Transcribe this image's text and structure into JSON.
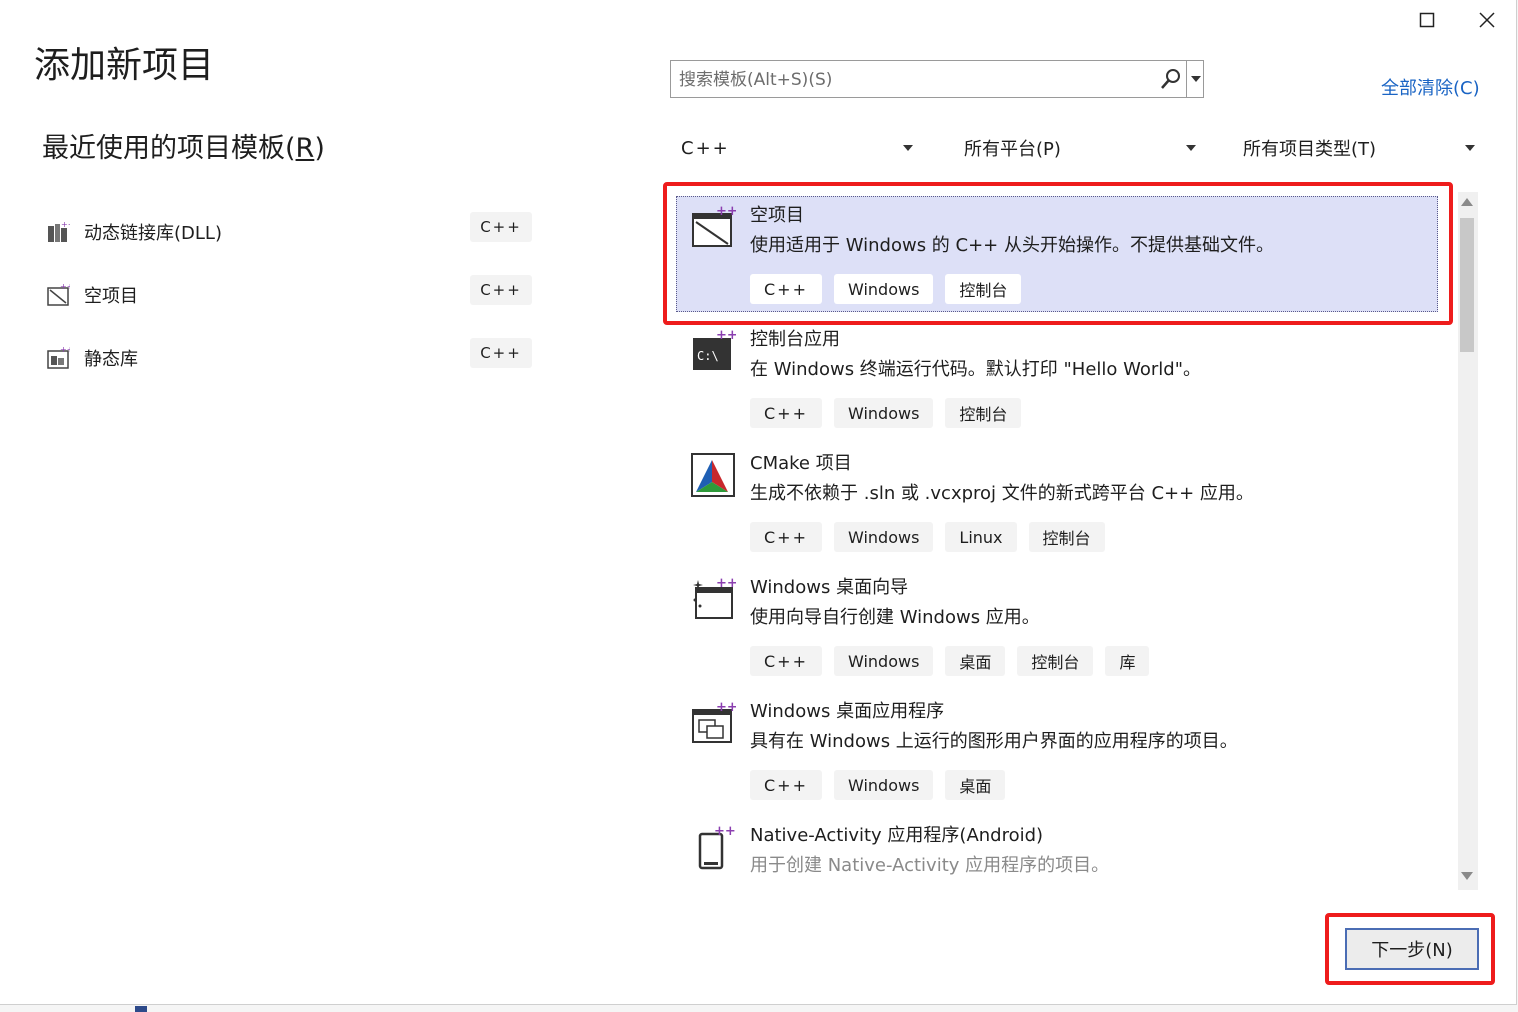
{
  "window": {
    "title": "添加新项目",
    "maximize_icon": "maximize-icon",
    "close_icon": "close-icon"
  },
  "recent": {
    "title": "最近使用的项目模板(",
    "title_key": "R",
    "title_end": ")",
    "items": [
      {
        "label": "动态链接库(DLL)",
        "lang": "C++",
        "icon": "dll-project-icon"
      },
      {
        "label": "空项目",
        "lang": "C++",
        "icon": "empty-project-icon"
      },
      {
        "label": "静态库",
        "lang": "C++",
        "icon": "static-library-icon"
      }
    ]
  },
  "search": {
    "placeholder": "搜索模板(Alt+S)(S)"
  },
  "clear_all": "全部清除(C)",
  "filters": {
    "language": "C++",
    "platform": "所有平台(P)",
    "project_type": "所有项目类型(T)"
  },
  "templates": [
    {
      "name": "空项目",
      "desc": "使用适用于 Windows 的 C++ 从头开始操作。不提供基础文件。",
      "tags": [
        "C++",
        "Windows",
        "控制台"
      ],
      "icon": "empty-project-icon",
      "selected": true
    },
    {
      "name": "控制台应用",
      "desc": "在 Windows 终端运行代码。默认打印 \"Hello World\"。",
      "tags": [
        "C++",
        "Windows",
        "控制台"
      ],
      "icon": "console-app-icon"
    },
    {
      "name": "CMake 项目",
      "desc": "生成不依赖于 .sln 或 .vcxproj 文件的新式跨平台 C++ 应用。",
      "tags": [
        "C++",
        "Windows",
        "Linux",
        "控制台"
      ],
      "icon": "cmake-icon"
    },
    {
      "name": "Windows 桌面向导",
      "desc": "使用向导自行创建 Windows 应用。",
      "tags": [
        "C++",
        "Windows",
        "桌面",
        "控制台",
        "库"
      ],
      "icon": "desktop-wizard-icon"
    },
    {
      "name": "Windows 桌面应用程序",
      "desc": "具有在 Windows 上运行的图形用户界面的应用程序的项目。",
      "tags": [
        "C++",
        "Windows",
        "桌面"
      ],
      "icon": "desktop-app-icon"
    },
    {
      "name": "Native-Activity 应用程序(Android)",
      "desc": "用于创建 Native-Activity 应用程序的项目。",
      "tags": [],
      "icon": "android-native-icon"
    }
  ],
  "next_button": "下一步(N)",
  "colors": {
    "accent": "#1a64c4",
    "selection": "#dde0f7",
    "highlight": "#ee1c1c",
    "cpp_plus": "#8b3fb0"
  }
}
